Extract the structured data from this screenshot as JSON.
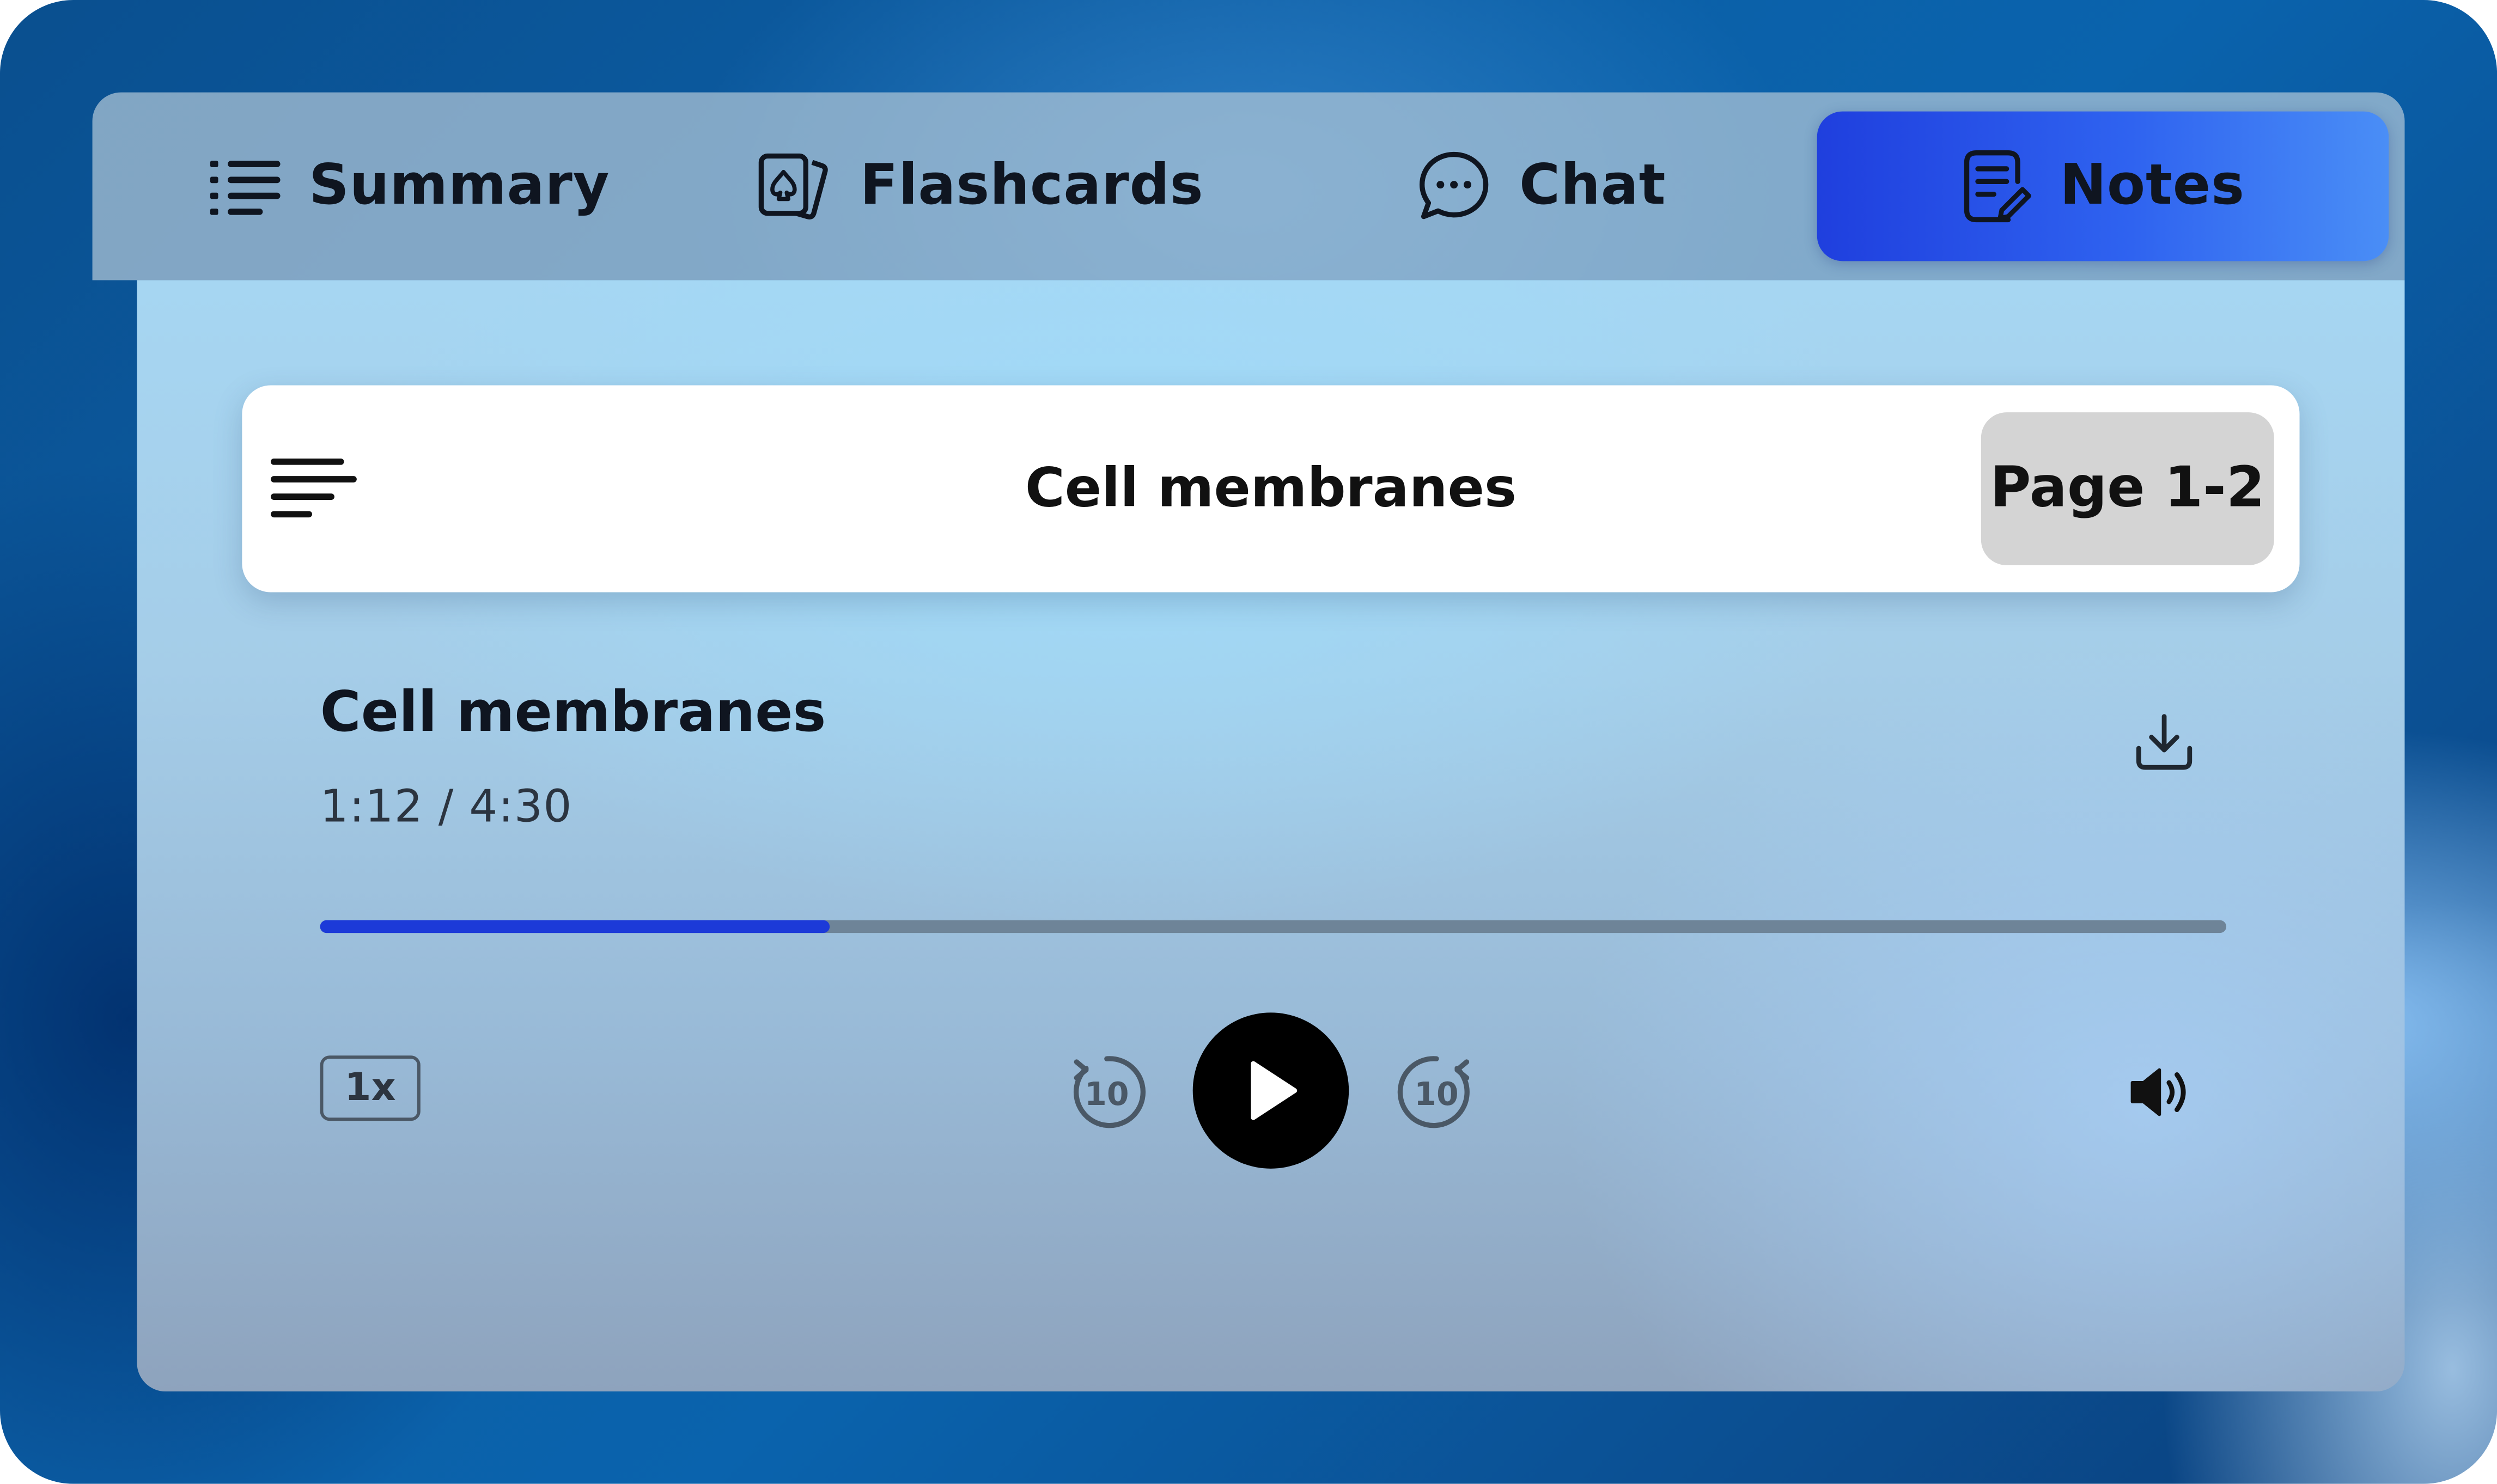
{
  "tabs": {
    "summary": {
      "label": "Summary",
      "icon": "list-icon"
    },
    "flashcards": {
      "label": "Flashcards",
      "icon": "cards-icon"
    },
    "chat": {
      "label": "Chat",
      "icon": "chat-bubble-icon"
    },
    "notes": {
      "label": "Notes",
      "icon": "notes-edit-icon",
      "active": true
    }
  },
  "colors": {
    "active_tab": "#2f63f0",
    "progress_fill": "#1c3ad8",
    "progress_track": "#6e8498"
  },
  "title_bar": {
    "menu_icon": "menu-lines-icon",
    "title": "Cell membranes",
    "page_range": "Page 1-2"
  },
  "player": {
    "title": "Cell membranes",
    "time": "1:12 / 4:30",
    "progress_fraction": 0.267,
    "speed": "1x",
    "skip_back_seconds": "10",
    "skip_forward_seconds": "10",
    "icons": {
      "download": "download-icon",
      "rewind": "rewind-10-icon",
      "play": "play-icon",
      "forward": "forward-10-icon",
      "volume": "volume-icon"
    }
  }
}
